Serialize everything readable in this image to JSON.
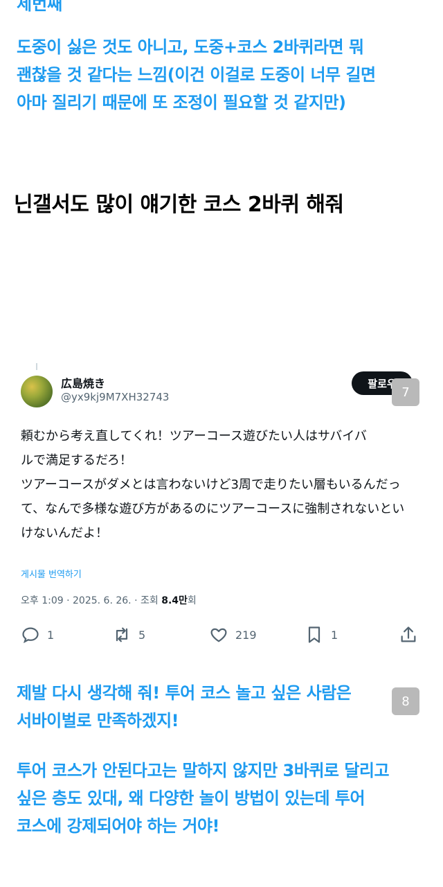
{
  "top_cut_text": "세번째",
  "translation_top": "도중이 싫은 것도 아니고, 도중+코스 2바퀴라면 뭐\n괜찮을 것 같다는 느낌(이건 이걸로 도중이 너무 길면\n아마 질리기 때문에 또 조정이 필요할 것 같지만)",
  "caption": "닌갤서도 많이 얘기한 코스 2바퀴 해줘",
  "tweet": {
    "display_name": "広島焼き",
    "handle": "@yx9kj9M7XH32743",
    "follow_label": "팔로우",
    "body": "頼むから考え直してくれ！ツアーコース遊びたい人はサバイバ\nルで満足するだろ！\nツアーコースがダメとは言わないけど3周で走りたい層もいるんだっ\nて、なんで多様な遊び方があるのにツアーコースに強制されないとい\nけないんだよ！",
    "translate_label": "게시물 번역하기",
    "time": "오후 1:09",
    "date": "2025. 6. 26.",
    "views_label": "조회",
    "views_count": "8.4만",
    "views_suffix": "회",
    "replies": "1",
    "retweets": "5",
    "likes": "219",
    "bookmarks": "1"
  },
  "badges": {
    "first": "7",
    "second": "8"
  },
  "translation_bottom_1": "제발 다시 생각해 줘! 투어 코스 놀고 싶은 사람은\n서바이벌로 만족하겠지!",
  "translation_bottom_2": "투어 코스가 안된다고는 말하지 않지만 3바퀴로 달리고\n싶은 층도 있대, 왜 다양한 놀이 방법이 있는데 투어\n코스에 강제되어야 하는 거야!",
  "icons": [
    "reply-icon",
    "retweet-icon",
    "like-icon",
    "bookmark-icon",
    "share-icon"
  ],
  "colors": {
    "accent_blue": "#1d9bf0",
    "text_dark": "#0f1419",
    "text_gray": "#536471",
    "badge_gray": "#b9b9b9"
  }
}
